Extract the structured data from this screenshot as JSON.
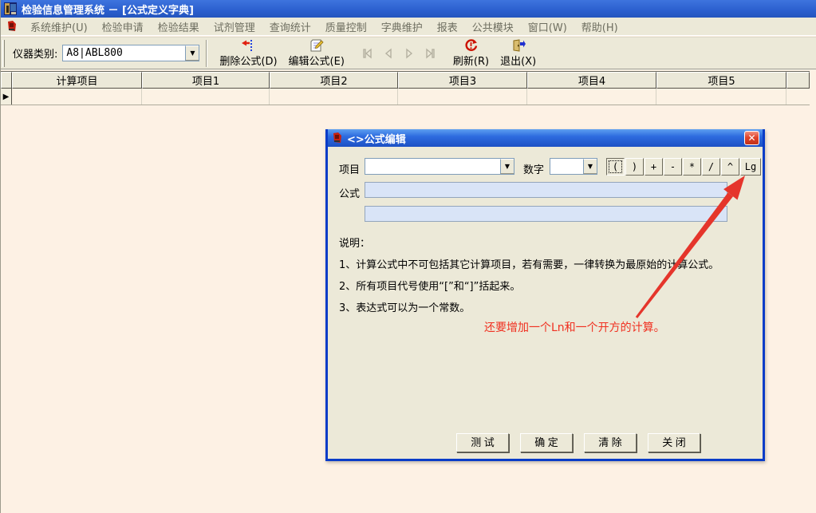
{
  "window": {
    "title": "检验信息管理系统 － [公式定义字典]"
  },
  "menu": {
    "items": [
      "系统维护(U)",
      "检验申请",
      "检验结果",
      "试剂管理",
      "查询统计",
      "质量控制",
      "字典维护",
      "报表",
      "公共模块",
      "窗口(W)",
      "帮助(H)"
    ]
  },
  "toolbar": {
    "instrument_label": "仪器类别:",
    "instrument_value": "A8|ABL800",
    "dropdown_arrow": "▼",
    "delete_label": "删除公式(D)",
    "edit_label": "编辑公式(E)",
    "refresh_label": "刷新(R)",
    "exit_label": "退出(X)"
  },
  "grid": {
    "columns": [
      "计算项目",
      "项目1",
      "项目2",
      "项目3",
      "项目4",
      "项目5"
    ],
    "row_indicator": "▶"
  },
  "dialog": {
    "title": "<>公式编辑",
    "close_glyph": "✕",
    "item_label": "项目",
    "number_label": "数字",
    "operators": [
      "(",
      ")",
      "+",
      "-",
      "*",
      "/",
      "^",
      "Lg"
    ],
    "formula_label": "公式",
    "notes_title": "说明：",
    "notes": [
      "1、计算公式中不可包括其它计算项目，若有需要，一律转换为最原始的计算公式。",
      "2、所有项目代号使用“[”和“]”括起来。",
      "3、表达式可以为一个常数。"
    ],
    "annotation": "还要增加一个Ln和一个开方的计算。",
    "buttons": [
      "测 试",
      "确 定",
      "清 除",
      "关 闭"
    ]
  },
  "colors": {
    "accent_blue": "#2B5FCE",
    "dialog_border": "#0A3CC8",
    "annotation_red": "#F03020",
    "arrow_red": "#E5352B",
    "client_bg": "#FDF1E4",
    "chrome_bg": "#ECE9D8",
    "field_blue": "#D9E4F7"
  }
}
